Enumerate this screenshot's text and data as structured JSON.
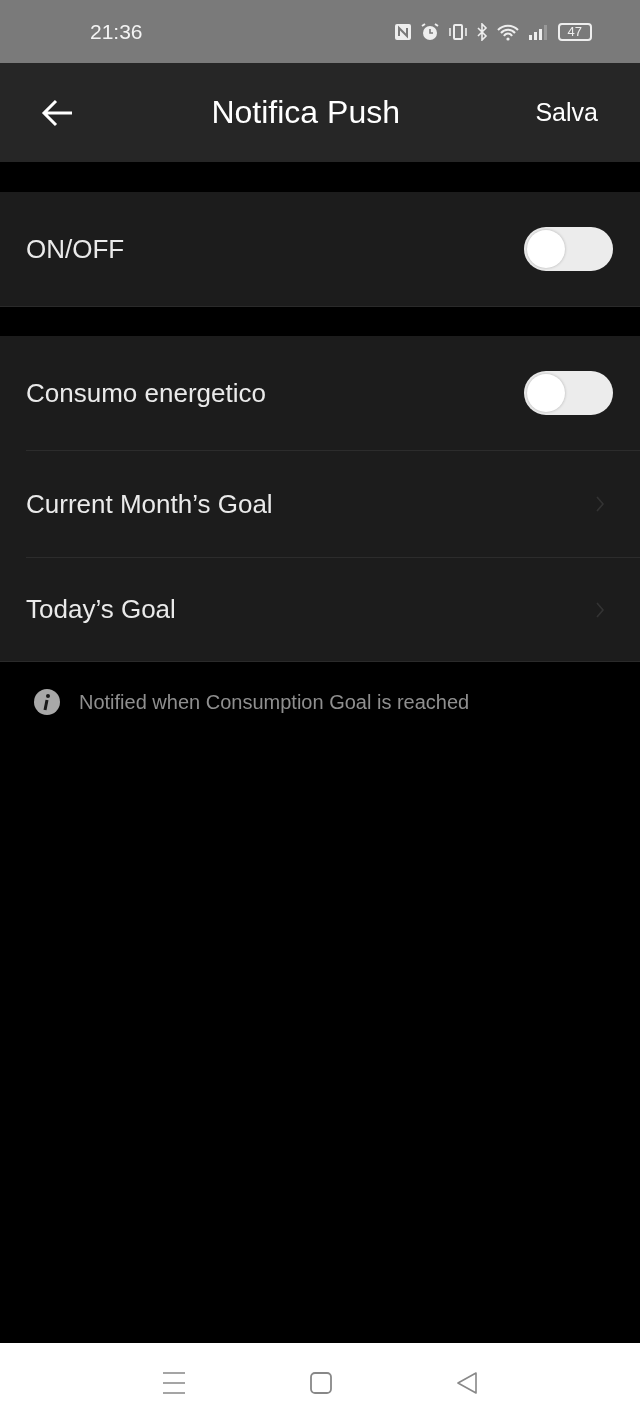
{
  "status_bar": {
    "time": "21:36",
    "battery": "47"
  },
  "header": {
    "title": "Notifica Push",
    "action": "Salva"
  },
  "sections": [
    {
      "rows": [
        {
          "kind": "toggle",
          "label": "ON/OFF",
          "on": false
        }
      ]
    },
    {
      "rows": [
        {
          "kind": "toggle",
          "label": "Consumo energetico",
          "on": false
        },
        {
          "kind": "link",
          "label": "Current Month’s Goal"
        },
        {
          "kind": "link",
          "label": "Today’s Goal"
        }
      ]
    }
  ],
  "note": "Notified when Consumption Goal is reached"
}
